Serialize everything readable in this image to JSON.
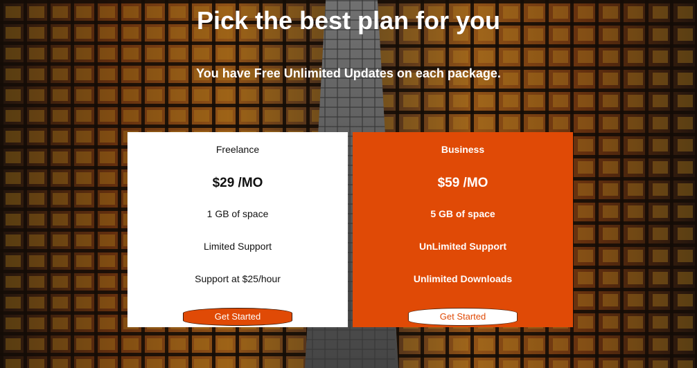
{
  "hero": {
    "title": "Pick the best plan for you",
    "subtitle": "You have Free Unlimited Updates on each package."
  },
  "plans": [
    {
      "name": "Freelance",
      "price": "$29 /MO",
      "features": [
        "1 GB of space",
        "Limited Support",
        "Support at $25/hour"
      ],
      "cta_label": "Get Started"
    },
    {
      "name": "Business",
      "price": "$59 /MO",
      "features": [
        "5 GB of space",
        "UnLimited Support",
        "Unlimited Downloads"
      ],
      "cta_label": "Get Started"
    }
  ],
  "colors": {
    "accent": "#e04a06",
    "card_light": "#ffffff",
    "text_dark": "#111111",
    "text_light": "#ffffff"
  }
}
